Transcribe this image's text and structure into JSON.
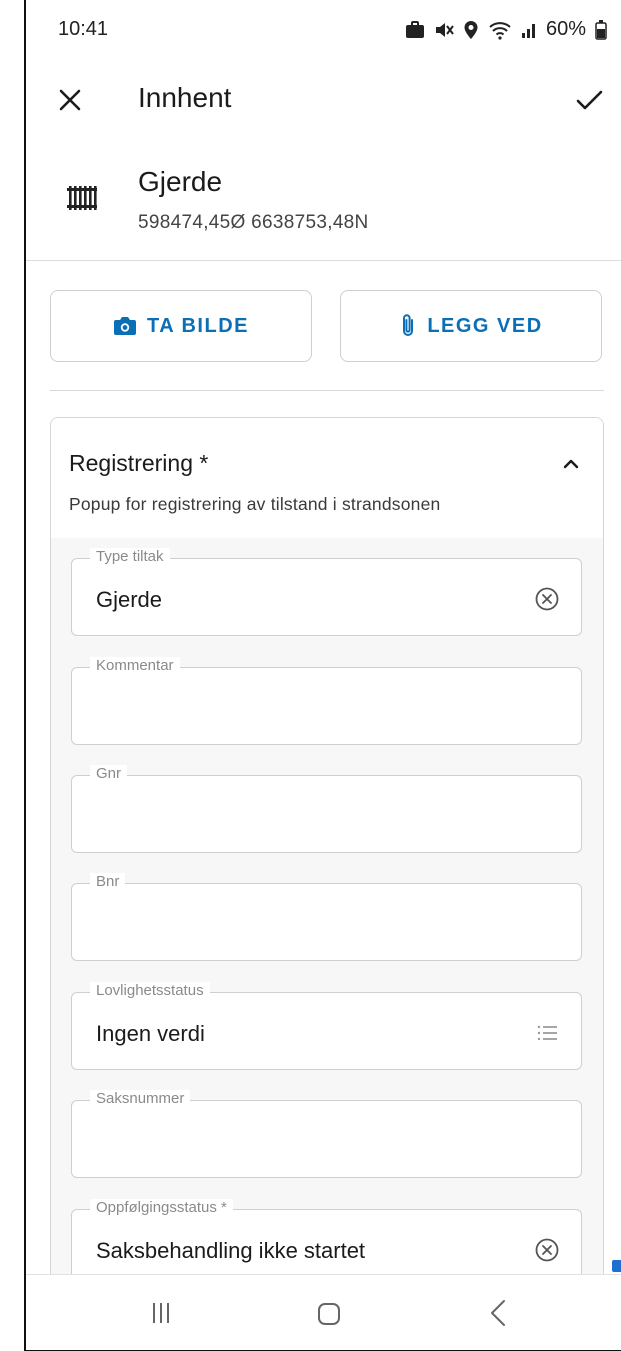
{
  "statusbar": {
    "time": "10:41",
    "battery": "60%",
    "icons": [
      "briefcase-icon",
      "mute-icon",
      "location-icon",
      "wifi-icon",
      "signal-icon",
      "battery-icon"
    ]
  },
  "appbar": {
    "title": "Innhent",
    "close_icon": "close-icon",
    "confirm_icon": "check-icon"
  },
  "feature": {
    "title": "Gjerde",
    "coordinates": "598474,45Ø 6638753,48N",
    "icon": "fence-icon"
  },
  "actions": {
    "take_photo": "TA BILDE",
    "attach": "LEGG VED"
  },
  "card": {
    "title": "Registrering *",
    "subtitle": "Popup for registrering av tilstand i strandsonen",
    "fields": [
      {
        "label": "Type tiltak",
        "value": "Gjerde",
        "icon": "clear-icon"
      },
      {
        "label": "Kommentar",
        "value": ""
      },
      {
        "label": "Gnr",
        "value": ""
      },
      {
        "label": "Bnr",
        "value": ""
      },
      {
        "label": "Lovlighetsstatus",
        "value": "Ingen verdi",
        "icon": "list-icon"
      },
      {
        "label": "Saksnummer",
        "value": ""
      },
      {
        "label": "Oppfølgingsstatus *",
        "value": "Saksbehandling ikke startet",
        "icon": "clear-icon"
      }
    ]
  },
  "colors": {
    "accent": "#0b6fb6",
    "border": "#cfcfcf",
    "label": "#8a8a8a"
  }
}
